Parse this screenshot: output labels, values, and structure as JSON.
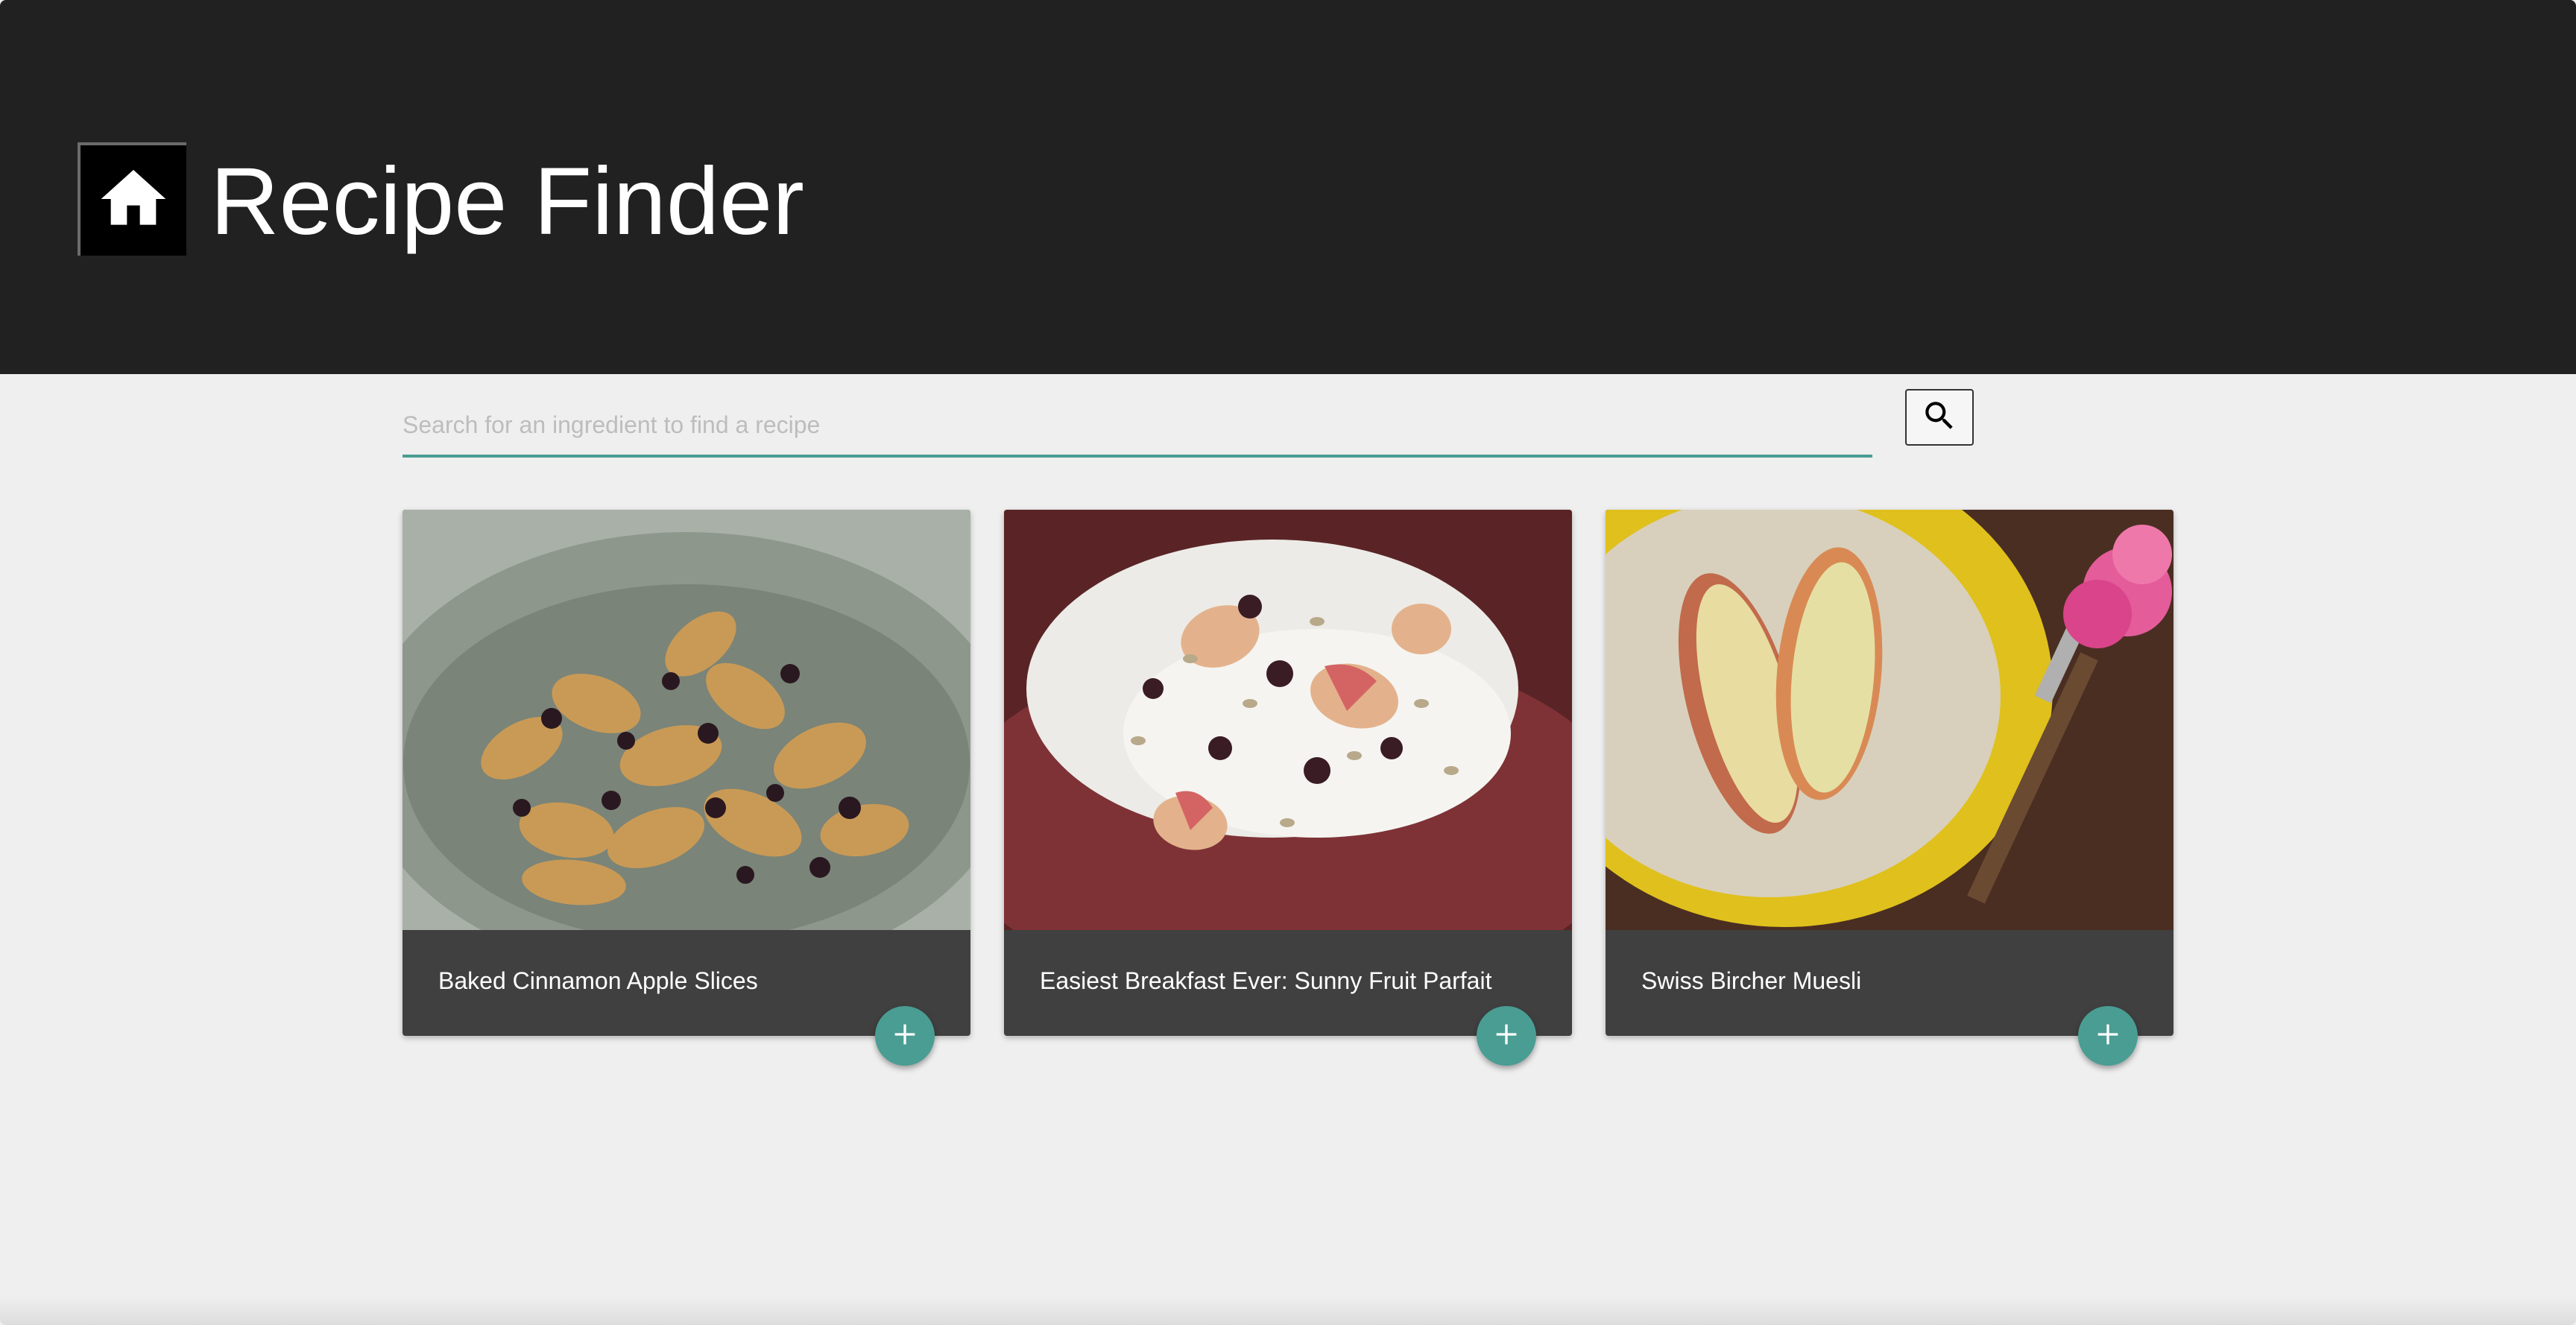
{
  "header": {
    "title": "Recipe Finder",
    "home_icon": "home-icon",
    "background": "#212121"
  },
  "search": {
    "placeholder": "Search for an ingredient to find a recipe",
    "value": "",
    "button_icon": "search-icon",
    "accent": "#4a9d93"
  },
  "recipes": [
    {
      "title": "Baked Cinnamon Apple Slices",
      "image": "baked-apple-slices-photo",
      "add_icon": "plus-icon"
    },
    {
      "title": "Easiest Breakfast Ever: Sunny Fruit Parfait",
      "image": "fruit-parfait-photo",
      "add_icon": "plus-icon"
    },
    {
      "title": "Swiss Bircher Muesli",
      "image": "bircher-muesli-photo",
      "add_icon": "plus-icon"
    }
  ]
}
